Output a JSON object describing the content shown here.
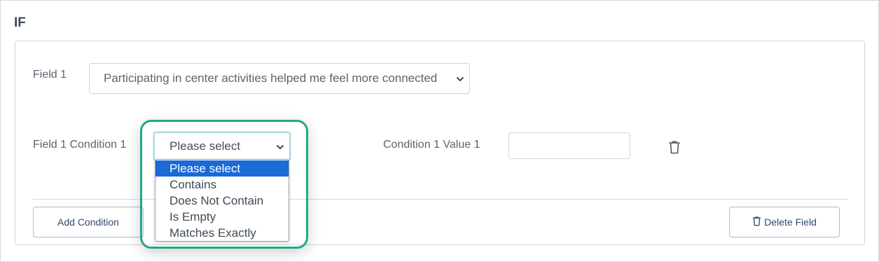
{
  "section": {
    "title": "IF"
  },
  "row1": {
    "field_label": "Field 1",
    "field_value": "Participating in center activities helped me feel more connected"
  },
  "row2": {
    "condition_label": "Field 1 Condition 1",
    "condition_value": "Please select",
    "value_label": "Condition 1 Value 1",
    "value_input": "",
    "delete_icon": "trash-icon"
  },
  "dropdown": {
    "options": [
      "Please select",
      "Contains",
      "Does Not Contain",
      "Is Empty",
      "Matches Exactly"
    ],
    "selected_index": 0
  },
  "actions": {
    "add_condition": "Add Condition",
    "delete_field": "Delete Field"
  },
  "colors": {
    "highlight": "#21a88a",
    "selected_option": "#1a6ad8",
    "button_text": "#2c4a6e"
  }
}
